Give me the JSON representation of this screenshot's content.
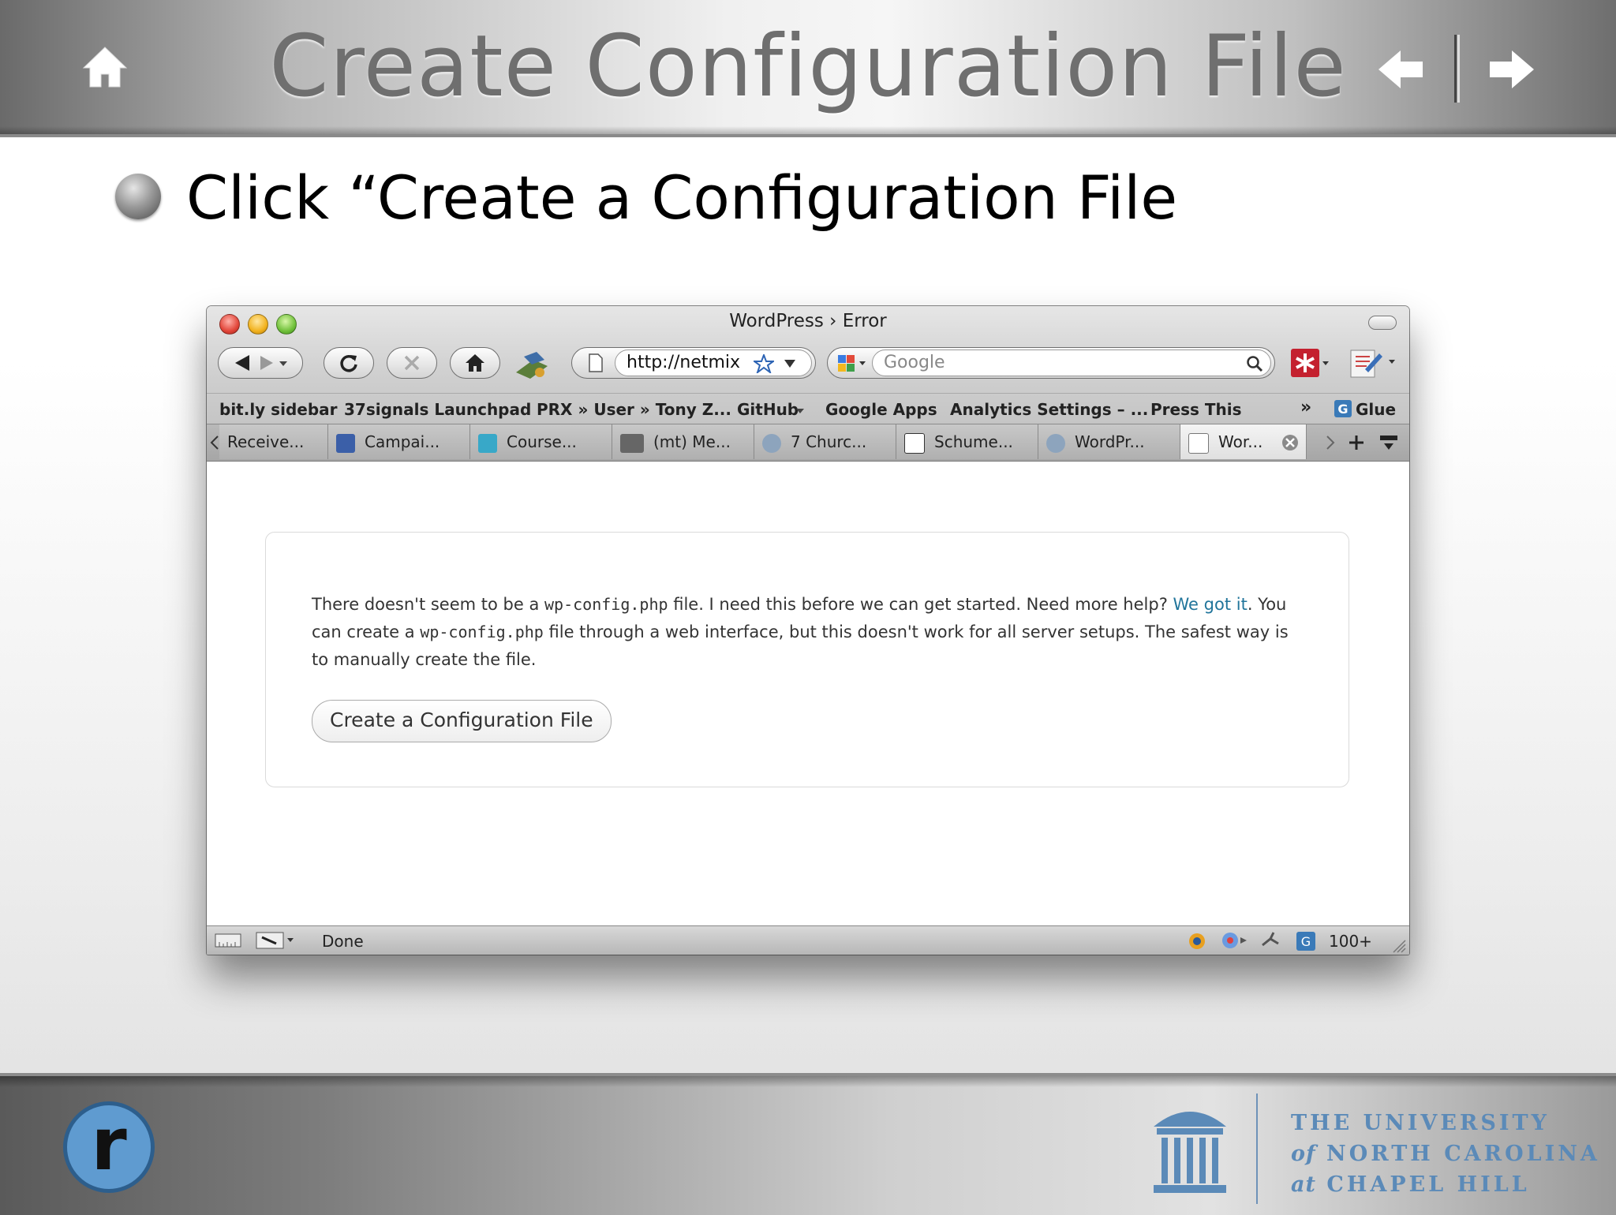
{
  "slide": {
    "title": "Create Configuration File",
    "bullet": "Click “Create a Configuration File",
    "footer": {
      "logo_letter": "r",
      "university_line1": "THE UNIVERSITY",
      "university_of": "of",
      "university_line2": "NORTH CAROLINA",
      "university_at": "at",
      "university_line3": "CHAPEL HILL"
    }
  },
  "browser": {
    "window_title": "WordPress › Error",
    "url": "http://netmix",
    "search_placeholder": "Google",
    "bookmarks": [
      "bit.ly sidebar",
      "37signals Launchpad",
      "PRX » User » Tony Z...",
      "GitHub",
      "Google Apps",
      "Analytics Settings – ...",
      "Press This",
      "»",
      "Glue"
    ],
    "tabs": [
      "Receive...",
      "Campai...",
      "Course...",
      "(mt) Me...",
      "7 Churc...",
      "Schume...",
      "WordPr...",
      "Wor..."
    ],
    "status_text": "Done",
    "status_count": "100+"
  },
  "page": {
    "msg_part1": "There doesn't seem to be a ",
    "msg_code1": "wp-config.php",
    "msg_part2": " file. I need this before we can get started. Need more help? ",
    "msg_link": "We got it",
    "msg_part3": ". You can create a ",
    "msg_code2": "wp-config.php",
    "msg_part4": " file through a web interface, but this doesn't work for all server setups. The safest way is to manually create the file.",
    "button_label": "Create a Configuration File"
  },
  "colors": {
    "wp_link": "#21759b",
    "unc_blue": "#5b8ab8",
    "title_gray": "#6f6f6f"
  }
}
